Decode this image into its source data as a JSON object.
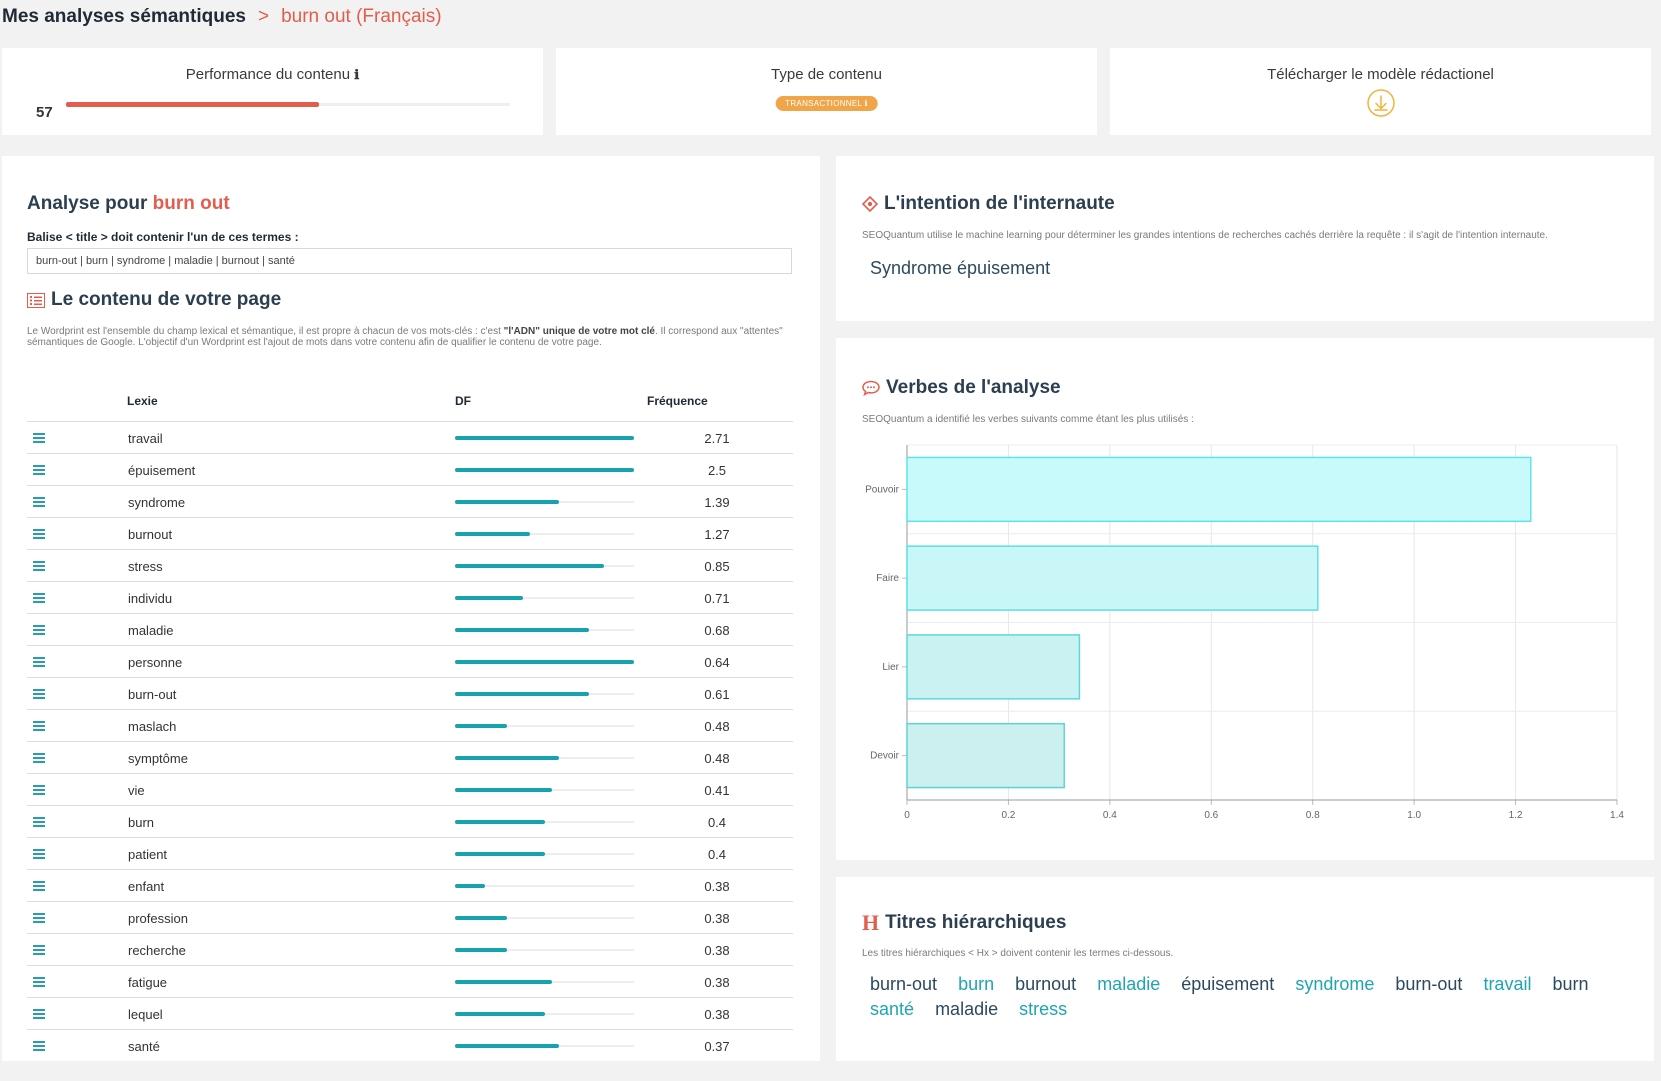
{
  "breadcrumb": {
    "root": "Mes analyses sémantiques",
    "separator": ">",
    "current": "burn out (Français)"
  },
  "top_cards": {
    "performance": {
      "title": "Performance du contenu",
      "info": "ℹ",
      "score": "57",
      "score_value": 57
    },
    "type": {
      "title": "Type de contenu",
      "badge": "TRANSACTIONNEL ℹ"
    },
    "download": {
      "title": "Télécharger le modèle rédactionel",
      "icon": "download-circle-icon"
    }
  },
  "analysis": {
    "title_prefix": "Analyse pour",
    "keyword": "burn out",
    "balise_label": "Balise < title > doit contenir l'un de ces termes :",
    "balise_terms": "burn-out | burn | syndrome | maladie | burnout | santé",
    "content_title": "Le contenu de votre page",
    "wordprint_desc_a": "Le Wordprint est l'ensemble du champ lexical et sémantique, il est propre à chacun de vos mots-clés : c'est ",
    "wordprint_desc_bold": "\"l'ADN\" unique de votre mot clé",
    "wordprint_desc_b": ". Il correspond aux \"attentes\" sémantiques de Google. L'objectif d'un Wordprint est l'ajout de mots dans votre contenu afin de qualifier le contenu de votre page.",
    "table": {
      "headers": {
        "lexie": "Lexie",
        "df": "DF",
        "freq": "Fréquence"
      },
      "rows": [
        {
          "lexie": "travail",
          "df": 1.0,
          "freq": "2.71"
        },
        {
          "lexie": "épuisement",
          "df": 1.0,
          "freq": "2.5"
        },
        {
          "lexie": "syndrome",
          "df": 0.58,
          "freq": "1.39"
        },
        {
          "lexie": "burnout",
          "df": 0.42,
          "freq": "1.27"
        },
        {
          "lexie": "stress",
          "df": 0.83,
          "freq": "0.85"
        },
        {
          "lexie": "individu",
          "df": 0.38,
          "freq": "0.71"
        },
        {
          "lexie": "maladie",
          "df": 0.75,
          "freq": "0.68"
        },
        {
          "lexie": "personne",
          "df": 1.0,
          "freq": "0.64"
        },
        {
          "lexie": "burn-out",
          "df": 0.75,
          "freq": "0.61"
        },
        {
          "lexie": "maslach",
          "df": 0.29,
          "freq": "0.48"
        },
        {
          "lexie": "symptôme",
          "df": 0.58,
          "freq": "0.48"
        },
        {
          "lexie": "vie",
          "df": 0.54,
          "freq": "0.41"
        },
        {
          "lexie": "burn",
          "df": 0.5,
          "freq": "0.4"
        },
        {
          "lexie": "patient",
          "df": 0.5,
          "freq": "0.4"
        },
        {
          "lexie": "enfant",
          "df": 0.17,
          "freq": "0.38"
        },
        {
          "lexie": "profession",
          "df": 0.29,
          "freq": "0.38"
        },
        {
          "lexie": "recherche",
          "df": 0.29,
          "freq": "0.38"
        },
        {
          "lexie": "fatigue",
          "df": 0.54,
          "freq": "0.38"
        },
        {
          "lexie": "lequel",
          "df": 0.5,
          "freq": "0.38"
        },
        {
          "lexie": "santé",
          "df": 0.58,
          "freq": "0.37"
        }
      ]
    }
  },
  "intention": {
    "title": "L'intention de l'internaute",
    "desc": "SEOQuantum utilise le machine learning pour déterminer les grandes intentions de recherches cachés derrière la requête : il s'agit de l'intention internaute.",
    "value": "Syndrome épuisement"
  },
  "verbes": {
    "title": "Verbes de l'analyse",
    "desc": "SEOQuantum a identifié les verbes suivants comme étant les plus utilisés :"
  },
  "chart_data": {
    "type": "bar",
    "orientation": "horizontal",
    "categories": [
      "Pouvoir",
      "Faire",
      "Lier",
      "Devoir"
    ],
    "values": [
      1.23,
      0.81,
      0.34,
      0.31
    ],
    "xlim": [
      0,
      1.4
    ],
    "xticks": [
      "0",
      "0.2",
      "0.4",
      "0.6",
      "0.8",
      "1.0",
      "1.2",
      "1.4"
    ],
    "tick_values": [
      0,
      0.2,
      0.4,
      0.6,
      0.8,
      1.0,
      1.2,
      1.4
    ],
    "grid": true,
    "colors": {
      "fills": [
        "#c9fafb",
        "#c9f6f6",
        "#caf2f2",
        "#ccf0f0"
      ],
      "strokes": [
        "#5fe3ea",
        "#5fdfe4",
        "#5fd8d8",
        "#5fd2d2"
      ]
    }
  },
  "titres": {
    "title": "Titres hiérarchiques",
    "desc": "Les titres hiérarchiques < Hx > doivent contenir les termes ci-dessous.",
    "words": [
      "burn-out",
      "burn",
      "burnout",
      "maladie",
      "épuisement",
      "syndrome",
      "burn-out",
      "travail",
      "burn",
      "santé",
      "maladie",
      "stress"
    ]
  },
  "colors": {
    "accent": "#e35d4e",
    "teal": "#17a2b0",
    "badge": "#f0a648",
    "word_dark": "#2c4a5e",
    "word_teal": "#1fa5b0"
  }
}
